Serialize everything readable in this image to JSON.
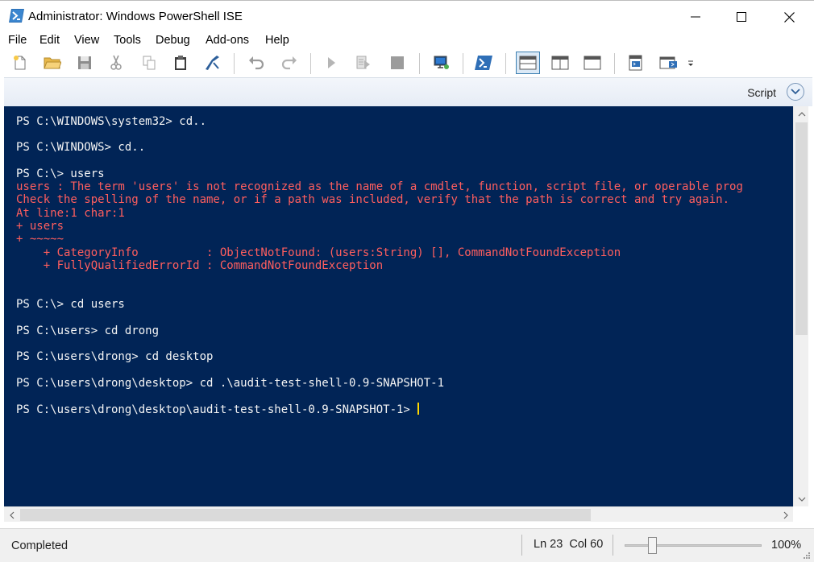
{
  "window": {
    "title": "Administrator: Windows PowerShell ISE"
  },
  "menu": [
    "File",
    "Edit",
    "View",
    "Tools",
    "Debug",
    "Add-ons",
    "Help"
  ],
  "toolbar": {
    "buttons": [
      "new-file",
      "open-folder",
      "save",
      "cut",
      "copy",
      "paste",
      "clear-console",
      "undo",
      "redo",
      "run-script",
      "run-selection",
      "stop",
      "new-remote-tab",
      "start-powershell",
      "show-script-top",
      "show-script-right",
      "show-script-maximized",
      "show-commands",
      "show-commands-addon",
      "toolbar-overflow"
    ]
  },
  "script_pane": {
    "label": "Script"
  },
  "console": {
    "lines": [
      {
        "text": "PS C:\\WINDOWS\\system32> cd..",
        "color": "white"
      },
      {
        "text": "PS C:\\WINDOWS> cd..",
        "color": "white"
      },
      {
        "text": "PS C:\\> users",
        "color": "white"
      },
      {
        "text": "users : The term 'users' is not recognized as the name of a cmdlet, function, script file, or operable prog",
        "color": "red"
      },
      {
        "text": "Check the spelling of the name, or if a path was included, verify that the path is correct and try again.",
        "color": "red"
      },
      {
        "text": "At line:1 char:1",
        "color": "red"
      },
      {
        "text": "+ users",
        "color": "red"
      },
      {
        "text": "+ ~~~~~",
        "color": "red"
      },
      {
        "text": "    + CategoryInfo          : ObjectNotFound: (users:String) [], CommandNotFoundException",
        "color": "red"
      },
      {
        "text": "    + FullyQualifiedErrorId : CommandNotFoundException",
        "color": "red"
      },
      {
        "text": "PS C:\\> cd users",
        "color": "white"
      },
      {
        "text": "PS C:\\users> cd drong",
        "color": "white"
      },
      {
        "text": "PS C:\\users\\drong> cd desktop",
        "color": "white"
      },
      {
        "text": "PS C:\\users\\drong\\desktop> cd .\\audit-test-shell-0.9-SNAPSHOT-1",
        "color": "white"
      },
      {
        "text": "PS C:\\users\\drong\\desktop\\audit-test-shell-0.9-SNAPSHOT-1> ",
        "color": "white"
      }
    ],
    "colors": {
      "background": "#012456",
      "foreground": "#f5f5f5",
      "error": "#ff5e5e",
      "cursor": "#ffd700"
    }
  },
  "status": {
    "text": "Completed",
    "line": "Ln 23",
    "col": "Col 60",
    "zoom": "100%",
    "zoom_level_fraction": 0.2
  }
}
